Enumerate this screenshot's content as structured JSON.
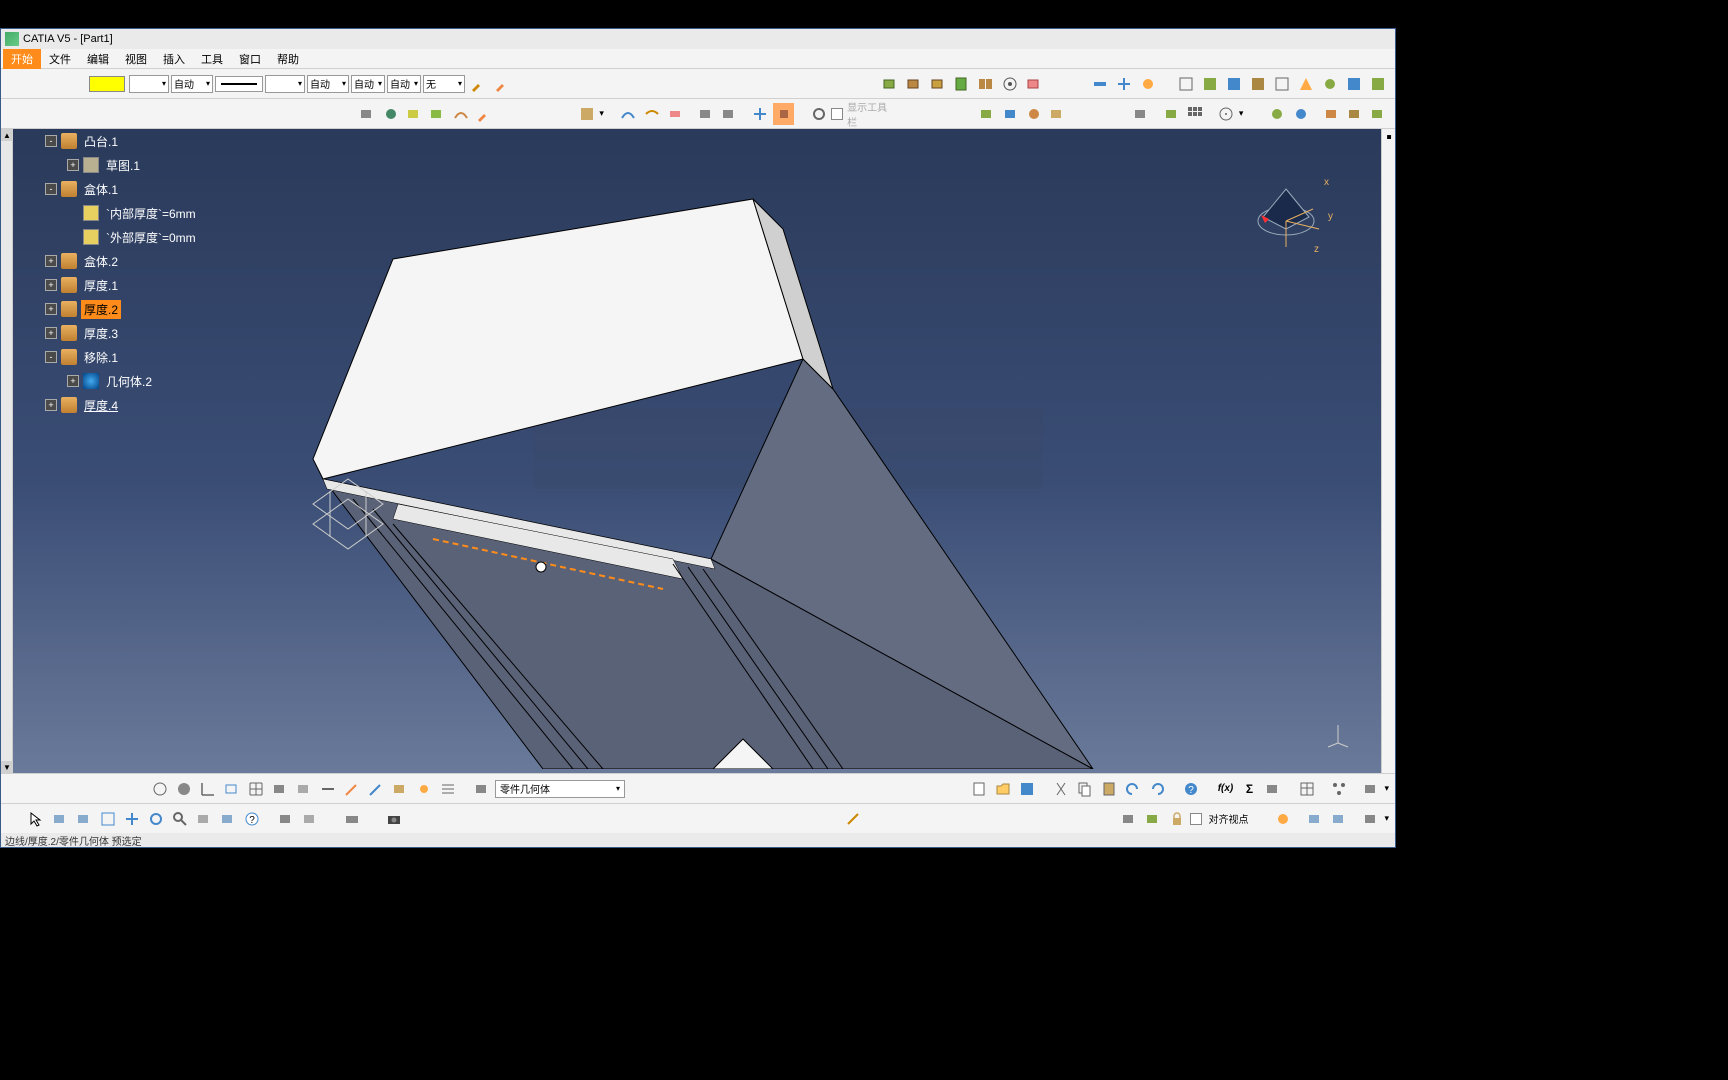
{
  "title": "CATIA V5 - [Part1]",
  "menu": {
    "start": "开始",
    "file": "文件",
    "edit": "编辑",
    "view": "视图",
    "insert": "插入",
    "tools": "工具",
    "window": "窗口",
    "help": "帮助"
  },
  "top_toolbar": {
    "auto1": "自动",
    "auto2": "自动",
    "auto3": "自动",
    "auto4": "自动",
    "none": "无"
  },
  "tree": {
    "items": [
      {
        "d": "d1",
        "exp": "-",
        "ico": "cyl",
        "label": "凸台.1"
      },
      {
        "d": "d2",
        "exp": "+",
        "ico": "sk",
        "label": "草图.1"
      },
      {
        "d": "d1",
        "exp": "-",
        "ico": "cyl",
        "label": "盒体.1"
      },
      {
        "d": "d2",
        "exp": "",
        "ico": "par",
        "label": "`内部厚度`=6mm"
      },
      {
        "d": "d2",
        "exp": "",
        "ico": "par",
        "label": "`外部厚度`=0mm"
      },
      {
        "d": "d1",
        "exp": "+",
        "ico": "cyl",
        "label": "盒体.2"
      },
      {
        "d": "d1",
        "exp": "+",
        "ico": "cyl",
        "label": "厚度.1"
      },
      {
        "d": "d1",
        "exp": "+",
        "ico": "cyl",
        "label": "厚度.2",
        "sel": true
      },
      {
        "d": "d1",
        "exp": "+",
        "ico": "cyl",
        "label": "厚度.3"
      },
      {
        "d": "d1",
        "exp": "-",
        "ico": "cyl",
        "label": "移除.1"
      },
      {
        "d": "d2",
        "exp": "+",
        "ico": "geo",
        "label": "几何体.2"
      },
      {
        "d": "d1",
        "exp": "+",
        "ico": "cyl",
        "label": "厚度.4",
        "under": true
      }
    ]
  },
  "axes": {
    "x": "x",
    "y": "y",
    "z": "z"
  },
  "bottom": {
    "current_body": "零件几何体",
    "align_label": "对齐视点"
  },
  "status": "边线/厚度.2/零件几何体 预选定"
}
